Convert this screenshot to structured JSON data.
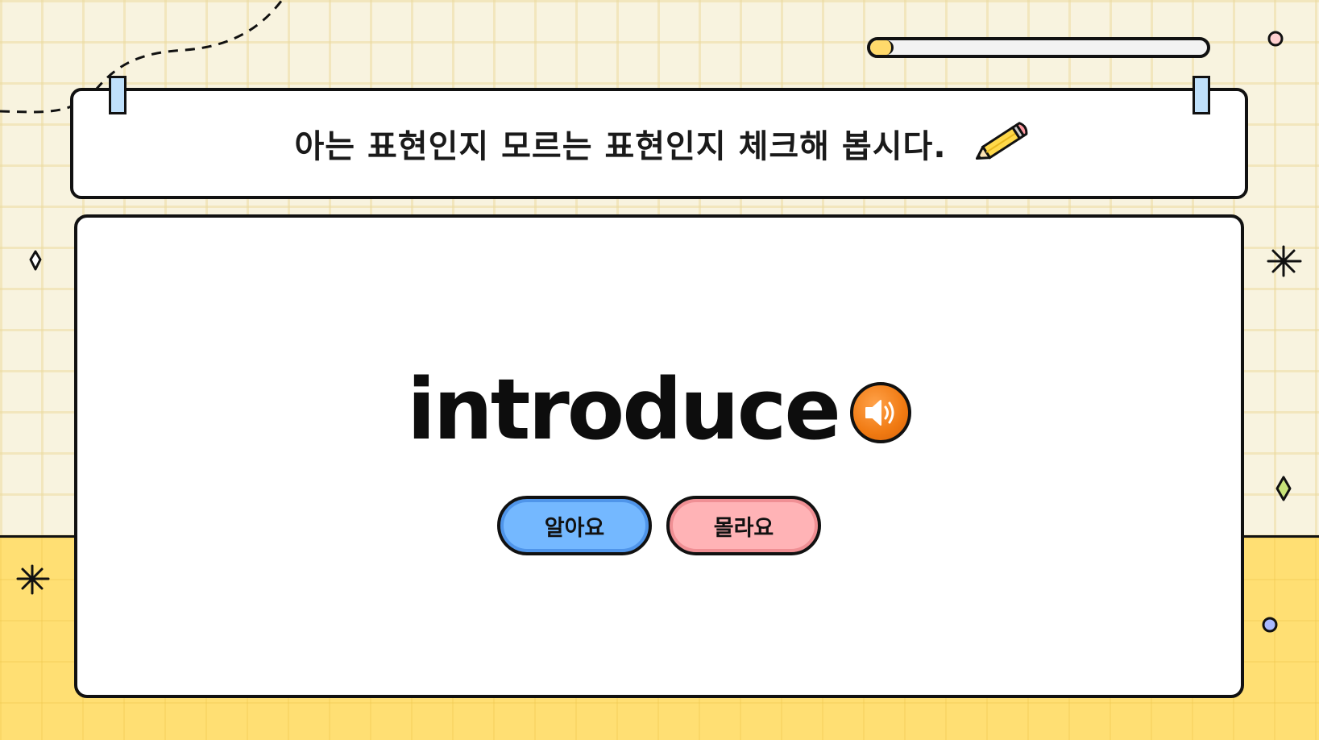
{
  "progress": {
    "value": 0.07
  },
  "banner": {
    "title": "아는 표현인지 모르는 표현인지 체크해 봅시다."
  },
  "card": {
    "word": "introduce",
    "buttons": {
      "know_label": "알아요",
      "dont_know_label": "몰라요"
    }
  },
  "colors": {
    "background": "#f8f3df",
    "floor": "#ffdf73",
    "know_button": "#74b8ff",
    "dont_know_button": "#ffb3b6",
    "speaker_button": "#f07a12",
    "progress_fill": "#ffd96b"
  },
  "icons": {
    "speaker": "speaker-icon",
    "pencil": "pencil-icon"
  }
}
